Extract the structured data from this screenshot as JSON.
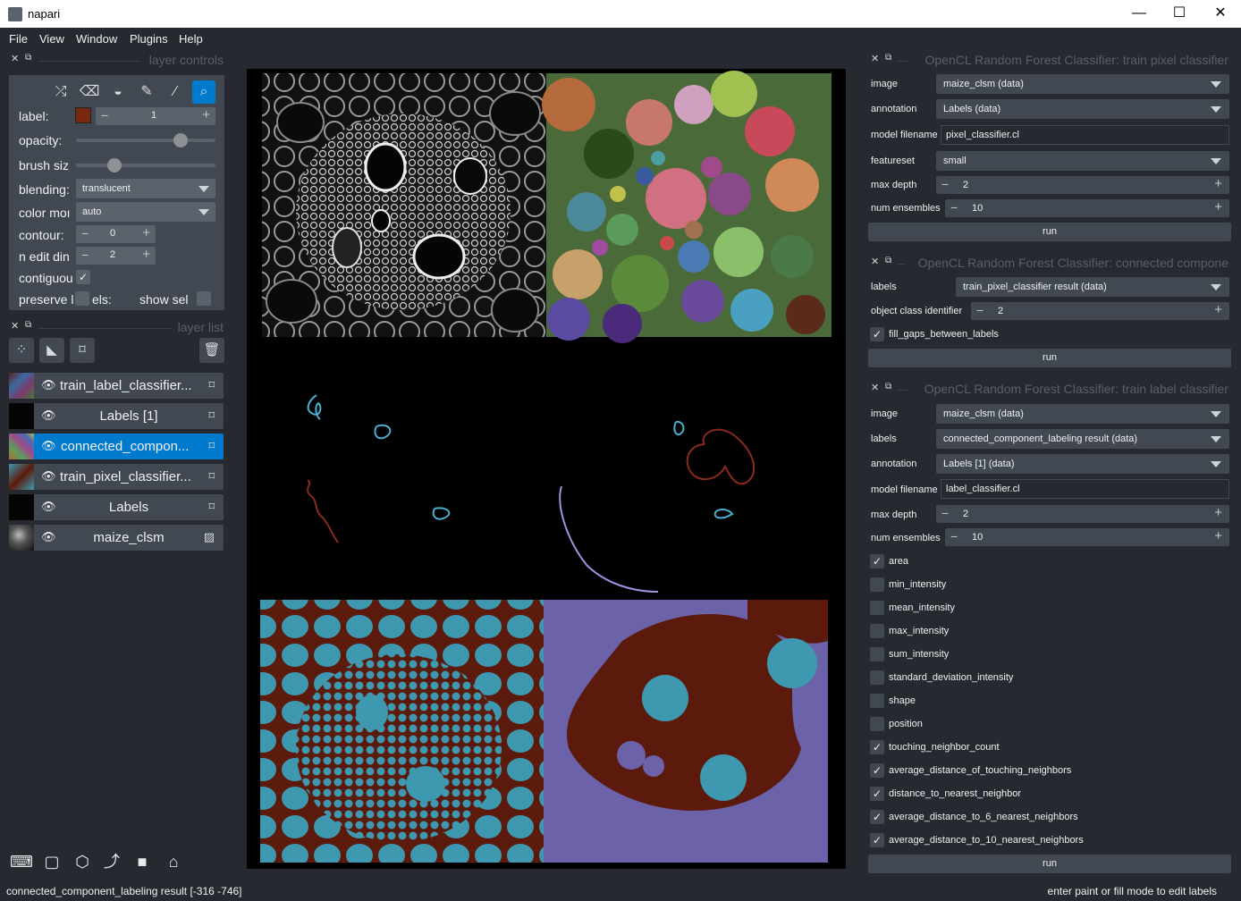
{
  "window": {
    "title": "napari",
    "minimize": "—",
    "maximize": "☐",
    "close": "✕"
  },
  "menu": [
    "File",
    "View",
    "Window",
    "Plugins",
    "Help"
  ],
  "docks": {
    "layer_controls_title": "layer controls",
    "layer_list_title": "layer list"
  },
  "layer_controls": {
    "label_label": "label:",
    "label_value": "1",
    "label_color": "#7a2712",
    "opacity_label": "opacity:",
    "opacity_value": 0.78,
    "brush_label": "brush siz",
    "brush_value": 0.25,
    "blending_label": "blending:",
    "blending_value": "translucent",
    "color_mode_label": "color moı",
    "color_mode_value": "auto",
    "contour_label": "contour:",
    "contour_value": "0",
    "n_edit_label": "n edit din",
    "n_edit_value": "2",
    "contiguous_label": "contiguou",
    "preserve_label": "preserve l",
    "preserve_label_tail": "els:",
    "show_selected_label": "show sel"
  },
  "layers": [
    {
      "name": "train_label_classifier...",
      "type": "label-icon",
      "selected": false
    },
    {
      "name": "Labels [1]",
      "type": "label-icon",
      "selected": false
    },
    {
      "name": "connected_compon...",
      "type": "label-icon",
      "selected": true
    },
    {
      "name": "train_pixel_classifier...",
      "type": "label-icon",
      "selected": false
    },
    {
      "name": "Labels",
      "type": "label-icon",
      "selected": false
    },
    {
      "name": "maize_clsm",
      "type": "image-icon",
      "selected": false
    }
  ],
  "status": {
    "left": "connected_component_labeling result [-316 -746]",
    "right": "enter paint or fill mode to edit labels"
  },
  "panel1": {
    "title": "OpenCL  Random  Forest  Classifier: train pixel classifier",
    "image_label": "image",
    "image_value": "maize_clsm (data)",
    "annotation_label": "annotation",
    "annotation_value": "Labels (data)",
    "model_label": "model filename",
    "model_value": "pixel_classifier.cl",
    "featureset_label": "featureset",
    "featureset_value": "small",
    "depth_label": "max depth",
    "depth_value": "2",
    "ensembles_label": "num ensembles",
    "ensembles_value": "10",
    "run": "run"
  },
  "panel2": {
    "title": "OpenCL  Random  Forest  Classifier: connected compone",
    "labels_label": "labels",
    "labels_value": "train_pixel_classifier result (data)",
    "object_label": "object class identifier",
    "object_value": "2",
    "fill_label": "fill_gaps_between_labels",
    "run": "run"
  },
  "panel3": {
    "title": "OpenCL  Random  Forest  Classifier: train label classifier",
    "image_label": "image",
    "image_value": "maize_clsm (data)",
    "labels_label": "labels",
    "labels_value": "connected_component_labeling result (data)",
    "annotation_label": "annotation",
    "annotation_value": "Labels [1] (data)",
    "model_label": "model filename",
    "model_value": "label_classifier.cl",
    "depth_label": "max depth",
    "depth_value": "2",
    "ensembles_label": "num ensembles",
    "ensembles_value": "10",
    "features": [
      {
        "name": "area",
        "checked": true
      },
      {
        "name": "min_intensity",
        "checked": false
      },
      {
        "name": "mean_intensity",
        "checked": false
      },
      {
        "name": "max_intensity",
        "checked": false
      },
      {
        "name": "sum_intensity",
        "checked": false
      },
      {
        "name": "standard_deviation_intensity",
        "checked": false
      },
      {
        "name": "shape",
        "checked": false
      },
      {
        "name": "position",
        "checked": false
      },
      {
        "name": "touching_neighbor_count",
        "checked": true
      },
      {
        "name": "average_distance_of_touching_neighbors",
        "checked": true
      },
      {
        "name": "distance_to_nearest_neighbor",
        "checked": true
      },
      {
        "name": "average_distance_to_6_nearest_neighbors",
        "checked": true
      },
      {
        "name": "average_distance_to_10_nearest_neighbors",
        "checked": true
      }
    ],
    "run": "run"
  },
  "colors": {
    "accent": "#007acc",
    "cyan_label": "#3d98b0",
    "brown_label": "#5c1a0c",
    "purple_label": "#6b62aa"
  }
}
